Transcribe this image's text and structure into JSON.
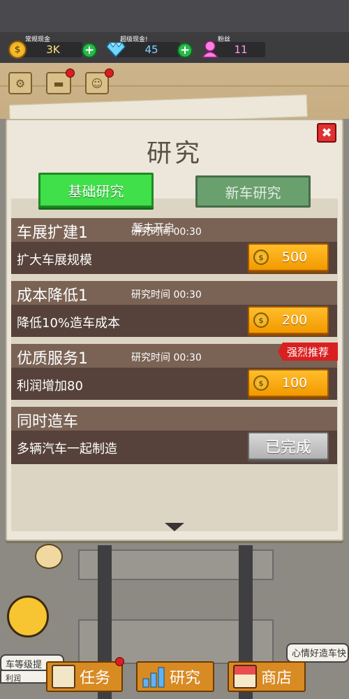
{
  "resources": [
    {
      "label": "常规现金",
      "value": "3K",
      "icon": "coin-icon"
    },
    {
      "label": "超级现金!",
      "value": "45",
      "icon": "diamond-icon"
    },
    {
      "label": "粉丝",
      "value": "11",
      "icon": "fan-icon"
    }
  ],
  "modal": {
    "title": "研究",
    "tabs": [
      {
        "label": "基础研究",
        "active": true
      },
      {
        "label": "新车研究",
        "active": false
      }
    ],
    "tip": "暂未开启",
    "items": [
      {
        "name": "车展扩建1",
        "time": "研究时间 00:30",
        "desc": "扩大车展规模",
        "price": "500",
        "status": "buy"
      },
      {
        "name": "成本降低1",
        "time": "研究时间 00:30",
        "desc": "降低10%造车成本",
        "price": "200",
        "status": "buy"
      },
      {
        "name": "优质服务1",
        "time": "研究时间 00:30",
        "desc": "利润增加80",
        "price": "100",
        "status": "buy",
        "badge": "强烈推荐"
      },
      {
        "name": "同时造车",
        "time": "",
        "desc": "多辆汽车一起制造",
        "price": "",
        "status": "done",
        "done_label": "已完成"
      }
    ]
  },
  "bottom_nav": [
    {
      "label": "任务",
      "icon": "clipboard-icon"
    },
    {
      "label": "研究",
      "icon": "bar-chart-icon"
    },
    {
      "label": "商店",
      "icon": "shop-icon"
    }
  ],
  "side_notes": {
    "left": "车等级提",
    "left_sub": "利润",
    "right": "心情好造车快"
  },
  "colors": {
    "active_tab": "#3fe04a",
    "buy_button": "#f29a00",
    "badge": "#d92020",
    "card_head": "#7a6355",
    "card_body": "#56423a"
  }
}
